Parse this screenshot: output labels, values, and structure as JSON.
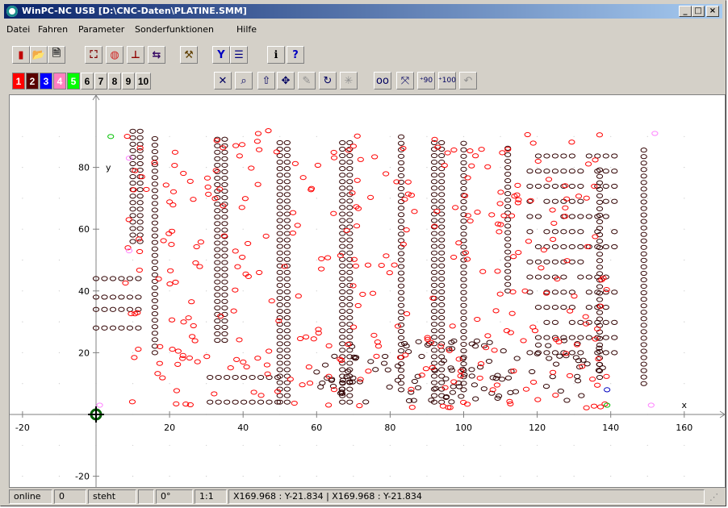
{
  "window": {
    "title": "WinPC-NC USB [D:\\CNC-Daten\\PLATINE.SMM]"
  },
  "menu": [
    "Datei",
    "Fahren",
    "Parameter",
    "Sonderfunktionen",
    "Hilfe"
  ],
  "toolbar1": [
    {
      "name": "exit-icon",
      "glyph": "▮",
      "color": "#c00000"
    },
    {
      "name": "open-folder-icon",
      "glyph": "📂",
      "color": "#c09000"
    },
    {
      "name": "document-icon",
      "glyph": "🗎",
      "color": "#333"
    },
    {
      "name": "view-fit-icon",
      "glyph": "⛶",
      "color": "#800000"
    },
    {
      "name": "color-wheel-icon",
      "glyph": "◍",
      "color": "#d02020"
    },
    {
      "name": "anchor-icon",
      "glyph": "⊥",
      "color": "#900000"
    },
    {
      "name": "jump-icon",
      "glyph": "⇆",
      "color": "#300060"
    },
    {
      "name": "tool-change-icon",
      "glyph": "⚒",
      "color": "#604000"
    },
    {
      "name": "filter-icon",
      "glyph": "Y",
      "color": "#0000c0"
    },
    {
      "name": "list-icon",
      "glyph": "☰",
      "color": "#000080"
    },
    {
      "name": "info-icon",
      "glyph": "ℹ",
      "color": "#000"
    },
    {
      "name": "help-icon",
      "glyph": "?",
      "color": "#0000c0"
    }
  ],
  "tool_numbers": [
    {
      "label": "1",
      "bg": "#ff0000"
    },
    {
      "label": "2",
      "bg": "#5a0000"
    },
    {
      "label": "3",
      "bg": "#0000ff"
    },
    {
      "label": "4",
      "bg": "#ff80c0"
    },
    {
      "label": "5",
      "bg": "#00ff00"
    },
    {
      "label": "6",
      "bg": "#d4d0c8"
    },
    {
      "label": "7",
      "bg": "#d4d0c8"
    },
    {
      "label": "8",
      "bg": "#d4d0c8"
    },
    {
      "label": "9",
      "bg": "#d4d0c8"
    },
    {
      "label": "10",
      "bg": "#d4d0c8"
    }
  ],
  "toolbar2": [
    {
      "name": "cancel-icon",
      "glyph": "✕"
    },
    {
      "name": "zoom-icon",
      "glyph": "⌕"
    },
    {
      "name": "up-arrow-icon",
      "glyph": "⇧"
    },
    {
      "name": "move-icon",
      "glyph": "✥"
    },
    {
      "name": "pen-icon",
      "glyph": "✎"
    },
    {
      "name": "rotate-icon",
      "glyph": "↻"
    },
    {
      "name": "star-icon",
      "glyph": "✳"
    },
    {
      "name": "glasses-icon",
      "glyph": "oo"
    },
    {
      "name": "mirror-icon",
      "glyph": "⤧"
    },
    {
      "name": "rotate-90-icon",
      "glyph": "⁺90"
    },
    {
      "name": "rotate-100-icon",
      "glyph": "⁺100"
    },
    {
      "name": "undo-icon",
      "glyph": "↶"
    }
  ],
  "plot": {
    "x_ticks": [
      "-20",
      "20",
      "40",
      "60",
      "80",
      "100",
      "120",
      "140",
      "160"
    ],
    "y_ticks": [
      "80",
      "60",
      "40",
      "20",
      "-20"
    ],
    "x_label": "x",
    "y_label": "y",
    "colors": {
      "hole": "#300000",
      "red": "#ff0000",
      "pink": "#ff80ff",
      "green": "#00c000",
      "blue": "#0000c0",
      "origin": "#006000"
    }
  },
  "status": {
    "conn": "online",
    "count": "0",
    "state": "steht",
    "empty": "",
    "angle": "0°",
    "scale": "1:1",
    "pos": "X169.968 : Y-21.834  |  X169.968 : Y-21.834"
  }
}
